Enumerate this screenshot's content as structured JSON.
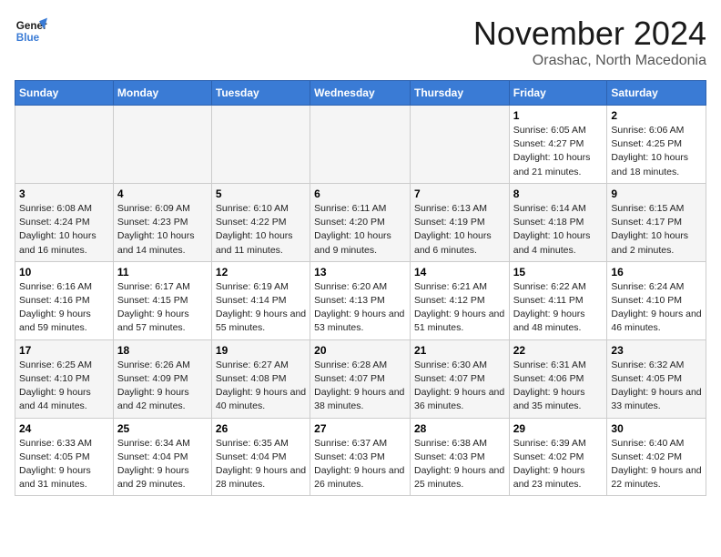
{
  "logo": {
    "line1": "General",
    "line2": "Blue"
  },
  "title": "November 2024",
  "location": "Orashac, North Macedonia",
  "days_of_week": [
    "Sunday",
    "Monday",
    "Tuesday",
    "Wednesday",
    "Thursday",
    "Friday",
    "Saturday"
  ],
  "weeks": [
    [
      {
        "num": "",
        "info": ""
      },
      {
        "num": "",
        "info": ""
      },
      {
        "num": "",
        "info": ""
      },
      {
        "num": "",
        "info": ""
      },
      {
        "num": "",
        "info": ""
      },
      {
        "num": "1",
        "info": "Sunrise: 6:05 AM\nSunset: 4:27 PM\nDaylight: 10 hours and 21 minutes."
      },
      {
        "num": "2",
        "info": "Sunrise: 6:06 AM\nSunset: 4:25 PM\nDaylight: 10 hours and 18 minutes."
      }
    ],
    [
      {
        "num": "3",
        "info": "Sunrise: 6:08 AM\nSunset: 4:24 PM\nDaylight: 10 hours and 16 minutes."
      },
      {
        "num": "4",
        "info": "Sunrise: 6:09 AM\nSunset: 4:23 PM\nDaylight: 10 hours and 14 minutes."
      },
      {
        "num": "5",
        "info": "Sunrise: 6:10 AM\nSunset: 4:22 PM\nDaylight: 10 hours and 11 minutes."
      },
      {
        "num": "6",
        "info": "Sunrise: 6:11 AM\nSunset: 4:20 PM\nDaylight: 10 hours and 9 minutes."
      },
      {
        "num": "7",
        "info": "Sunrise: 6:13 AM\nSunset: 4:19 PM\nDaylight: 10 hours and 6 minutes."
      },
      {
        "num": "8",
        "info": "Sunrise: 6:14 AM\nSunset: 4:18 PM\nDaylight: 10 hours and 4 minutes."
      },
      {
        "num": "9",
        "info": "Sunrise: 6:15 AM\nSunset: 4:17 PM\nDaylight: 10 hours and 2 minutes."
      }
    ],
    [
      {
        "num": "10",
        "info": "Sunrise: 6:16 AM\nSunset: 4:16 PM\nDaylight: 9 hours and 59 minutes."
      },
      {
        "num": "11",
        "info": "Sunrise: 6:17 AM\nSunset: 4:15 PM\nDaylight: 9 hours and 57 minutes."
      },
      {
        "num": "12",
        "info": "Sunrise: 6:19 AM\nSunset: 4:14 PM\nDaylight: 9 hours and 55 minutes."
      },
      {
        "num": "13",
        "info": "Sunrise: 6:20 AM\nSunset: 4:13 PM\nDaylight: 9 hours and 53 minutes."
      },
      {
        "num": "14",
        "info": "Sunrise: 6:21 AM\nSunset: 4:12 PM\nDaylight: 9 hours and 51 minutes."
      },
      {
        "num": "15",
        "info": "Sunrise: 6:22 AM\nSunset: 4:11 PM\nDaylight: 9 hours and 48 minutes."
      },
      {
        "num": "16",
        "info": "Sunrise: 6:24 AM\nSunset: 4:10 PM\nDaylight: 9 hours and 46 minutes."
      }
    ],
    [
      {
        "num": "17",
        "info": "Sunrise: 6:25 AM\nSunset: 4:10 PM\nDaylight: 9 hours and 44 minutes."
      },
      {
        "num": "18",
        "info": "Sunrise: 6:26 AM\nSunset: 4:09 PM\nDaylight: 9 hours and 42 minutes."
      },
      {
        "num": "19",
        "info": "Sunrise: 6:27 AM\nSunset: 4:08 PM\nDaylight: 9 hours and 40 minutes."
      },
      {
        "num": "20",
        "info": "Sunrise: 6:28 AM\nSunset: 4:07 PM\nDaylight: 9 hours and 38 minutes."
      },
      {
        "num": "21",
        "info": "Sunrise: 6:30 AM\nSunset: 4:07 PM\nDaylight: 9 hours and 36 minutes."
      },
      {
        "num": "22",
        "info": "Sunrise: 6:31 AM\nSunset: 4:06 PM\nDaylight: 9 hours and 35 minutes."
      },
      {
        "num": "23",
        "info": "Sunrise: 6:32 AM\nSunset: 4:05 PM\nDaylight: 9 hours and 33 minutes."
      }
    ],
    [
      {
        "num": "24",
        "info": "Sunrise: 6:33 AM\nSunset: 4:05 PM\nDaylight: 9 hours and 31 minutes."
      },
      {
        "num": "25",
        "info": "Sunrise: 6:34 AM\nSunset: 4:04 PM\nDaylight: 9 hours and 29 minutes."
      },
      {
        "num": "26",
        "info": "Sunrise: 6:35 AM\nSunset: 4:04 PM\nDaylight: 9 hours and 28 minutes."
      },
      {
        "num": "27",
        "info": "Sunrise: 6:37 AM\nSunset: 4:03 PM\nDaylight: 9 hours and 26 minutes."
      },
      {
        "num": "28",
        "info": "Sunrise: 6:38 AM\nSunset: 4:03 PM\nDaylight: 9 hours and 25 minutes."
      },
      {
        "num": "29",
        "info": "Sunrise: 6:39 AM\nSunset: 4:02 PM\nDaylight: 9 hours and 23 minutes."
      },
      {
        "num": "30",
        "info": "Sunrise: 6:40 AM\nSunset: 4:02 PM\nDaylight: 9 hours and 22 minutes."
      }
    ]
  ]
}
